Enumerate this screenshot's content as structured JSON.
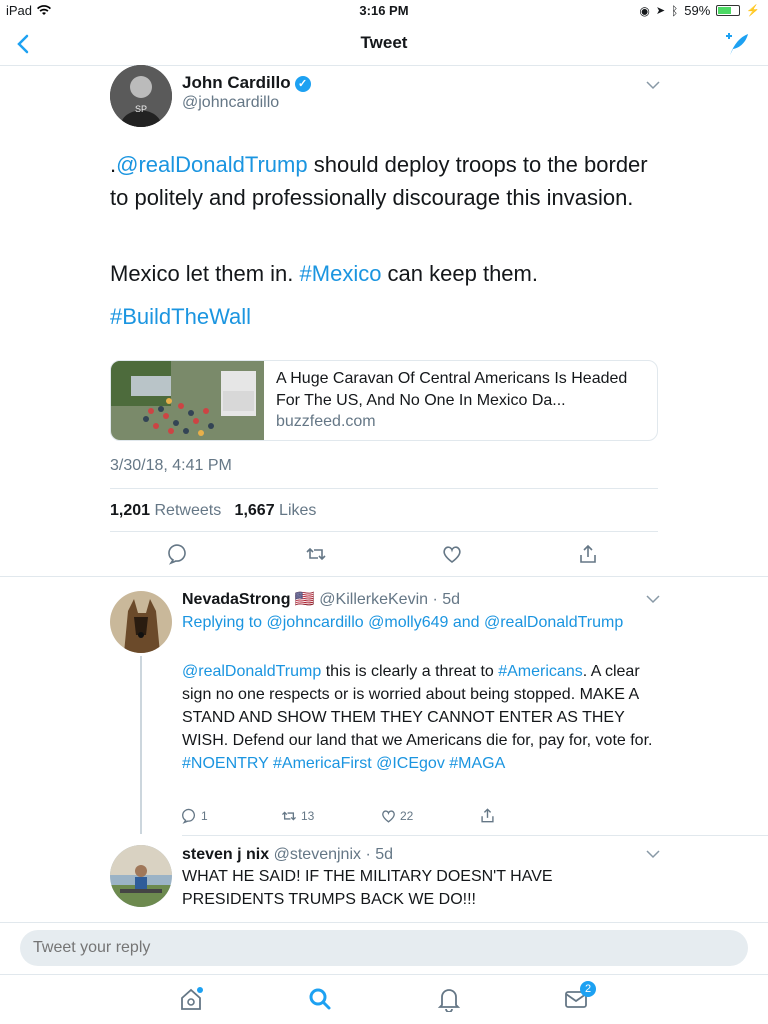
{
  "status": {
    "device": "iPad",
    "time": "3:16 PM",
    "battery": "59%"
  },
  "nav": {
    "title": "Tweet"
  },
  "tweet": {
    "name": "John Cardillo",
    "handle": "@johncardillo",
    "line1_prefix": ".",
    "line1_mention": "@realDonaldTrump",
    "line1_rest": " should deploy troops to the border to politely and professionally discourage this invasion.",
    "line2_a": "Mexico let them in. ",
    "line2_tag": "#Mexico",
    "line2_b": " can keep them.",
    "line3_tag": "#BuildTheWall",
    "card_title": "A Huge Caravan Of Central Americans Is Headed For The US, And No One In Mexico Da...",
    "card_domain": "buzzfeed.com",
    "date": "3/30/18, 4:41 PM",
    "retweets": "1,201",
    "retweets_label": "Retweets",
    "likes": "1,667",
    "likes_label": "Likes"
  },
  "reply1": {
    "name": "NevadaStrong",
    "flag": "🇺🇸",
    "handle_time": "@KillerkeKevin · 5d",
    "replying_prefix": "Replying to ",
    "replying_to": "@johncardillo @molly649 and @realDonaldTrump",
    "mention": "@realDonaldTrump",
    "text_a": " this is clearly a threat to ",
    "tag1": "#Americans",
    "text_b": ". A clear sign no one respects or is worried about being stopped. MAKE A STAND AND SHOW THEM THEY CANNOT ENTER AS THEY WISH. Defend our land that we Americans die for, pay for, vote for. ",
    "tags_end": "#NOENTRY #AmericaFirst @ICEgov #MAGA",
    "replies": "1",
    "retweets": "13",
    "likes": "22"
  },
  "reply2": {
    "name": "steven j nix",
    "handle_time": "@stevenjnix · 5d",
    "text": "WHAT HE SAID! IF THE MILITARY DOESN'T HAVE PRESIDENTS TRUMPS BACK WE DO!!!"
  },
  "compose": {
    "placeholder": "Tweet your reply"
  },
  "tabs": {
    "messages_badge": "2"
  },
  "colors": {
    "accent": "#1da1f2",
    "link": "#1b95e0",
    "muted": "#657786"
  }
}
